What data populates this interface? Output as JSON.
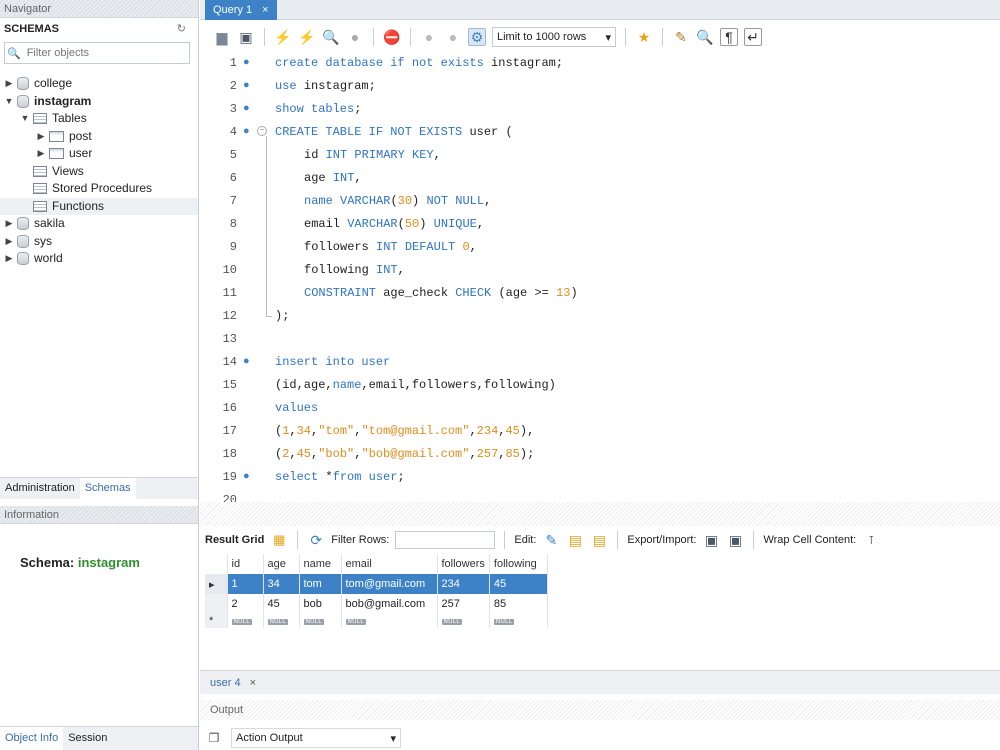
{
  "navigator": {
    "title": "Navigator",
    "schemas_label": "SCHEMAS",
    "filter_placeholder": "Filter objects",
    "tree": [
      {
        "label": "college",
        "type": "db",
        "level": 0,
        "expanded": false,
        "bold": false
      },
      {
        "label": "instagram",
        "type": "db",
        "level": 0,
        "expanded": true,
        "bold": true
      },
      {
        "label": "Tables",
        "type": "folder",
        "level": 1,
        "expanded": true,
        "bold": false
      },
      {
        "label": "post",
        "type": "table",
        "level": 2,
        "expanded": false,
        "bold": false
      },
      {
        "label": "user",
        "type": "table",
        "level": 2,
        "expanded": false,
        "bold": false
      },
      {
        "label": "Views",
        "type": "folder",
        "level": 1,
        "expanded": null,
        "bold": false
      },
      {
        "label": "Stored Procedures",
        "type": "folder",
        "level": 1,
        "expanded": null,
        "bold": false
      },
      {
        "label": "Functions",
        "type": "folder",
        "level": 1,
        "expanded": null,
        "bold": false
      },
      {
        "label": "sakila",
        "type": "db",
        "level": 0,
        "expanded": false,
        "bold": false
      },
      {
        "label": "sys",
        "type": "db",
        "level": 0,
        "expanded": false,
        "bold": false
      },
      {
        "label": "world",
        "type": "db",
        "level": 0,
        "expanded": false,
        "bold": false
      }
    ],
    "tabs": {
      "administration": "Administration",
      "schemas": "Schemas"
    },
    "information_title": "Information",
    "schema_label": "Schema:",
    "schema_value": "instagram",
    "bottom_tabs": {
      "object_info": "Object Info",
      "session": "Session"
    }
  },
  "query_tab": {
    "label": "Query 1",
    "close": "×"
  },
  "toolbar": {
    "limit_label": "Limit to 1000 rows"
  },
  "editor": {
    "lines": [
      {
        "n": "1",
        "dot": true,
        "fold": false,
        "indent": 0,
        "tokens": [
          [
            "kw",
            "create database if not exists "
          ],
          [
            "pl",
            "instagram;"
          ]
        ]
      },
      {
        "n": "2",
        "dot": true,
        "fold": false,
        "indent": 0,
        "tokens": [
          [
            "kw",
            "use "
          ],
          [
            "pl",
            "instagram;"
          ]
        ]
      },
      {
        "n": "3",
        "dot": true,
        "fold": false,
        "indent": 0,
        "tokens": [
          [
            "kw",
            "show tables"
          ],
          [
            "pl",
            ";"
          ]
        ]
      },
      {
        "n": "4",
        "dot": true,
        "fold": true,
        "indent": 0,
        "tokens": [
          [
            "kw",
            "CREATE TABLE IF NOT EXISTS "
          ],
          [
            "pl",
            "user ("
          ]
        ]
      },
      {
        "n": "5",
        "dot": false,
        "fold": false,
        "indent": 1,
        "tokens": [
          [
            "pl",
            "id "
          ],
          [
            "kw",
            "INT PRIMARY KEY"
          ],
          [
            "pl",
            ","
          ]
        ]
      },
      {
        "n": "6",
        "dot": false,
        "fold": false,
        "indent": 1,
        "tokens": [
          [
            "pl",
            "age "
          ],
          [
            "kw",
            "INT"
          ],
          [
            "pl",
            ","
          ]
        ]
      },
      {
        "n": "7",
        "dot": false,
        "fold": false,
        "indent": 1,
        "tokens": [
          [
            "kw",
            "name "
          ],
          [
            "kw",
            "VARCHAR"
          ],
          [
            "pl",
            "("
          ],
          [
            "nm",
            "30"
          ],
          [
            "pl",
            ") "
          ],
          [
            "kw",
            "NOT NULL"
          ],
          [
            "pl",
            ","
          ]
        ]
      },
      {
        "n": "8",
        "dot": false,
        "fold": false,
        "indent": 1,
        "tokens": [
          [
            "pl",
            "email "
          ],
          [
            "kw",
            "VARCHAR"
          ],
          [
            "pl",
            "("
          ],
          [
            "nm",
            "50"
          ],
          [
            "pl",
            ") "
          ],
          [
            "kw",
            "UNIQUE"
          ],
          [
            "pl",
            ","
          ]
        ]
      },
      {
        "n": "9",
        "dot": false,
        "fold": false,
        "indent": 1,
        "tokens": [
          [
            "pl",
            "followers "
          ],
          [
            "kw",
            "INT DEFAULT "
          ],
          [
            "nm",
            "0"
          ],
          [
            "pl",
            ","
          ]
        ]
      },
      {
        "n": "10",
        "dot": false,
        "fold": false,
        "indent": 1,
        "tokens": [
          [
            "pl",
            "following "
          ],
          [
            "kw",
            "INT"
          ],
          [
            "pl",
            ","
          ]
        ]
      },
      {
        "n": "11",
        "dot": false,
        "fold": false,
        "indent": 1,
        "tokens": [
          [
            "kw",
            "CONSTRAINT "
          ],
          [
            "pl",
            "age_check "
          ],
          [
            "kw",
            "CHECK "
          ],
          [
            "pl",
            "(age >= "
          ],
          [
            "nm",
            "13"
          ],
          [
            "pl",
            ")"
          ]
        ]
      },
      {
        "n": "12",
        "dot": false,
        "fold": false,
        "indent": 0,
        "tokens": [
          [
            "pl",
            ");"
          ]
        ]
      },
      {
        "n": "13",
        "dot": false,
        "fold": false,
        "indent": 0,
        "tokens": []
      },
      {
        "n": "14",
        "dot": true,
        "fold": false,
        "indent": 0,
        "tokens": [
          [
            "kw",
            "insert into "
          ],
          [
            "kw",
            "user"
          ]
        ]
      },
      {
        "n": "15",
        "dot": false,
        "fold": false,
        "indent": 0,
        "tokens": [
          [
            "pl",
            "(id,age,"
          ],
          [
            "kw",
            "name"
          ],
          [
            "pl",
            ",email,followers,following)"
          ]
        ]
      },
      {
        "n": "16",
        "dot": false,
        "fold": false,
        "indent": 0,
        "tokens": [
          [
            "kw",
            "values"
          ]
        ]
      },
      {
        "n": "17",
        "dot": false,
        "fold": false,
        "indent": 0,
        "tokens": [
          [
            "pl",
            "("
          ],
          [
            "nm",
            "1"
          ],
          [
            "pl",
            ","
          ],
          [
            "nm",
            "34"
          ],
          [
            "pl",
            ","
          ],
          [
            "st",
            "\"tom\""
          ],
          [
            "pl",
            ","
          ],
          [
            "st",
            "\"tom@gmail.com\""
          ],
          [
            "pl",
            ","
          ],
          [
            "nm",
            "234"
          ],
          [
            "pl",
            ","
          ],
          [
            "nm",
            "45"
          ],
          [
            "pl",
            "),"
          ]
        ]
      },
      {
        "n": "18",
        "dot": false,
        "fold": false,
        "indent": 0,
        "tokens": [
          [
            "pl",
            "("
          ],
          [
            "nm",
            "2"
          ],
          [
            "pl",
            ","
          ],
          [
            "nm",
            "45"
          ],
          [
            "pl",
            ","
          ],
          [
            "st",
            "\"bob\""
          ],
          [
            "pl",
            ","
          ],
          [
            "st",
            "\"bob@gmail.com\""
          ],
          [
            "pl",
            ","
          ],
          [
            "nm",
            "257"
          ],
          [
            "pl",
            ","
          ],
          [
            "nm",
            "85"
          ],
          [
            "pl",
            ");"
          ]
        ]
      },
      {
        "n": "19",
        "dot": true,
        "fold": false,
        "indent": 0,
        "tokens": [
          [
            "kw",
            "select "
          ],
          [
            "pl",
            "*"
          ],
          [
            "kw",
            "from "
          ],
          [
            "kw",
            "user"
          ],
          [
            "pl",
            ";"
          ]
        ]
      },
      {
        "n": "20",
        "dot": false,
        "fold": false,
        "indent": 0,
        "tokens": []
      }
    ]
  },
  "result_toolbar": {
    "result_grid": "Result Grid",
    "filter_rows": "Filter Rows:",
    "edit": "Edit:",
    "export_import": "Export/Import:",
    "wrap": "Wrap Cell Content:"
  },
  "grid": {
    "columns": [
      "id",
      "age",
      "name",
      "email",
      "followers",
      "following"
    ],
    "rows": [
      [
        "1",
        "34",
        "tom",
        "tom@gmail.com",
        "234",
        "45"
      ],
      [
        "2",
        "45",
        "bob",
        "bob@gmail.com",
        "257",
        "85"
      ]
    ],
    "null_label": "NULL",
    "new_row_marker": "*",
    "selected_marker": "▸"
  },
  "result_tab": {
    "label": "user 4",
    "close": "×"
  },
  "output": {
    "title": "Output",
    "select_value": "Action Output"
  }
}
